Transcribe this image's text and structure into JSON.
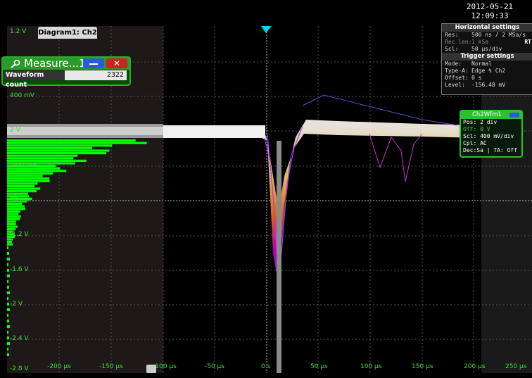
{
  "header": {
    "date": "2012-05-21",
    "time": "12:09:33"
  },
  "diagram": {
    "tab_label": "Diagram1: Ch2"
  },
  "measure_window": {
    "title": "Measure...1",
    "label": "Waveform count",
    "value": "2322"
  },
  "horizontal_settings": {
    "title": "Horizontal settings",
    "rows": [
      {
        "key": "Res:",
        "value": "500 ns / 2 MSa/s"
      },
      {
        "key": "Rec len:",
        "value": "1 kSa"
      },
      {
        "key": "Scl:",
        "value": "50 µs/div"
      }
    ],
    "rt_label": "RT"
  },
  "trigger_settings": {
    "title": "Trigger settings",
    "rows": [
      {
        "key": "Mode:",
        "value": "Normal"
      },
      {
        "key": "Type-A:",
        "value": "Edge ↯ Ch2"
      },
      {
        "key": "Offset:",
        "value": "0 s"
      },
      {
        "key": "Level:",
        "value": "-156.48 mV"
      }
    ]
  },
  "waveform_box": {
    "title": "Ch2Wfm1",
    "rows": [
      "Pos: 2 div",
      "Off: 0 V",
      "Scl: 400 mV/div",
      "Cpl: AC",
      "Dec:Sa | TA: Off"
    ]
  },
  "y_axis_labels": [
    "1.2 V",
    "400 mV",
    "-400 mV",
    "-1.2 V",
    "-1.6 V",
    "-2 V",
    "-2.4 V",
    "-2.8 V"
  ],
  "y_axis_partial": [
    "2 V",
    "00 mV"
  ],
  "x_axis_labels": [
    "-200 µs",
    "-150 µs",
    "-100 µs",
    "-50 µs",
    "0 s",
    "50 µs",
    "100 µs",
    "150 µs",
    "200 µs",
    "250 µs"
  ],
  "colors": {
    "grid": "#555555",
    "axis_label": "#3ee03e",
    "histogram": "#00ff00",
    "waveform_core": "#f0f0f0"
  },
  "icons": {
    "measure": "magnifier-icon",
    "minimize": "minimize-icon",
    "close": "close-icon",
    "trigger_marker": "trigger-triangle-icon"
  }
}
